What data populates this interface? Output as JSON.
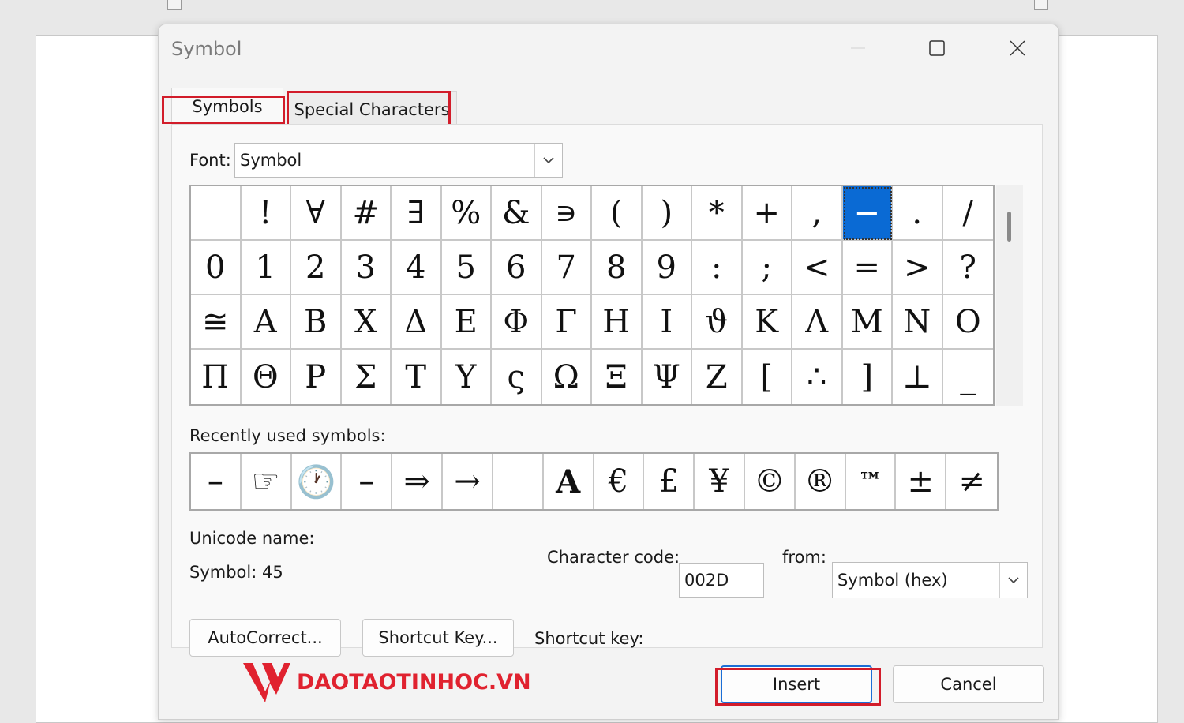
{
  "dialog": {
    "title": "Symbol",
    "controls": [
      "minimize-icon",
      "maximize-icon",
      "close-icon"
    ]
  },
  "tabs": [
    {
      "label": "Symbols",
      "active": true
    },
    {
      "label": "Special Characters",
      "active": false
    }
  ],
  "font": {
    "label": "Font:",
    "value": "Symbol"
  },
  "symbol_grid": {
    "rows": [
      [
        " ",
        "!",
        "∀",
        "#",
        "∃",
        "%",
        "&",
        "∍",
        "(",
        ")",
        "*",
        "+",
        ",",
        "−",
        ".",
        "/"
      ],
      [
        "0",
        "1",
        "2",
        "3",
        "4",
        "5",
        "6",
        "7",
        "8",
        "9",
        ":",
        ";",
        "<",
        "=",
        ">",
        "?"
      ],
      [
        "≅",
        "Α",
        "Β",
        "Χ",
        "Δ",
        "Ε",
        "Φ",
        "Γ",
        "Η",
        "Ι",
        "ϑ",
        "Κ",
        "Λ",
        "Μ",
        "Ν",
        "Ο"
      ],
      [
        "Π",
        "Θ",
        "Ρ",
        "Σ",
        "Τ",
        "Υ",
        "ς",
        "Ω",
        "Ξ",
        "Ψ",
        "Ζ",
        "[",
        "∴",
        "]",
        "⊥",
        "_"
      ]
    ],
    "selected": {
      "row": 0,
      "col": 13
    }
  },
  "recent": {
    "label": "Recently used symbols:",
    "items": [
      "–",
      "☞",
      "🕐",
      "–",
      "⇒",
      "→",
      " ",
      "A",
      "€",
      "£",
      "¥",
      "©",
      "®",
      "™",
      "±",
      "≠"
    ]
  },
  "unicode_name": {
    "label": "Unicode name:",
    "value": "Symbol: 45"
  },
  "char_code": {
    "label": "Character code:",
    "value": "002D",
    "from_label": "from:",
    "from_value": "Symbol (hex)"
  },
  "buttons": {
    "autocorrect": "AutoCorrect...",
    "shortcut_key": "Shortcut Key...",
    "shortcut_label": "Shortcut key:",
    "insert": "Insert",
    "cancel": "Cancel"
  },
  "watermark": {
    "text": "DAOTAOTINHOC.VN"
  },
  "colors": {
    "highlight": "#d21c2a",
    "selection": "#0a6ad4"
  }
}
